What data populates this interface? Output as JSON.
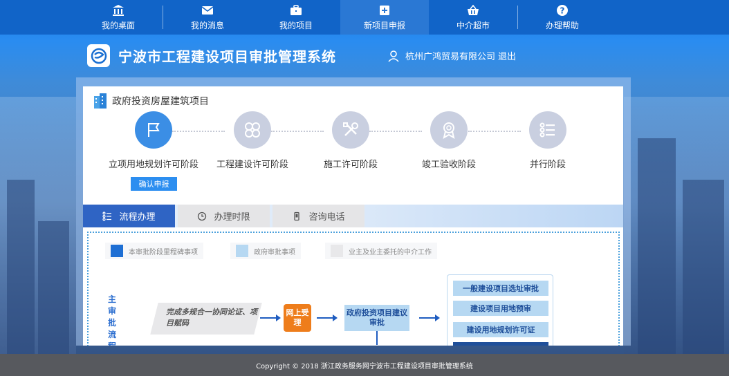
{
  "nav": {
    "items": [
      {
        "label": "我的桌面",
        "icon": "bank-icon"
      },
      {
        "label": "我的消息",
        "icon": "envelope-icon"
      },
      {
        "label": "我的项目",
        "icon": "briefcase-icon"
      },
      {
        "label": "新项目申报",
        "icon": "plus-square-icon"
      },
      {
        "label": "中介超市",
        "icon": "basket-icon"
      },
      {
        "label": "办理帮助",
        "icon": "question-icon"
      }
    ],
    "active_index": 3
  },
  "header": {
    "title": "宁波市工程建设项目审批管理系统",
    "user": "杭州广鸿贸易有限公司",
    "logout": "退出"
  },
  "project": {
    "title": "政府投资房屋建筑项目",
    "stages": [
      {
        "label": "立项用地规划许可阶段",
        "icon": "flag-icon",
        "active": true
      },
      {
        "label": "工程建设许可阶段",
        "icon": "circles-icon",
        "active": false
      },
      {
        "label": "施工许可阶段",
        "icon": "tools-icon",
        "active": false
      },
      {
        "label": "竣工验收阶段",
        "icon": "medal-icon",
        "active": false
      },
      {
        "label": "并行阶段",
        "icon": "list-icon",
        "active": false
      }
    ],
    "confirm_label": "确认申报"
  },
  "tabs": [
    {
      "label": "流程办理",
      "icon": "steps-icon",
      "active": true
    },
    {
      "label": "办理时限",
      "icon": "clock-icon",
      "active": false
    },
    {
      "label": "咨询电话",
      "icon": "phone-icon",
      "active": false
    }
  ],
  "legend": [
    {
      "label": "本审批阶段里程碑事项",
      "color": "#1e6fd4"
    },
    {
      "label": "政府审批事项",
      "color": "#b6d8f2"
    },
    {
      "label": "业主及业主委托的中介工作",
      "color": "#e8e8ea"
    }
  ],
  "flow": {
    "main_label": [
      "主",
      "审",
      "批",
      "流",
      "程"
    ],
    "step1": "完成多规合一协同论证、项目赋码",
    "step2": "网上受理",
    "step3": "政府投资项目建议审批",
    "approvals": [
      "一般建设项目选址审批",
      "建设项目用地预审",
      "建设用地规划许可证"
    ]
  },
  "footer": "Copyright © 2018 浙江政务服务网宁波市工程建设项目审批管理系统"
}
